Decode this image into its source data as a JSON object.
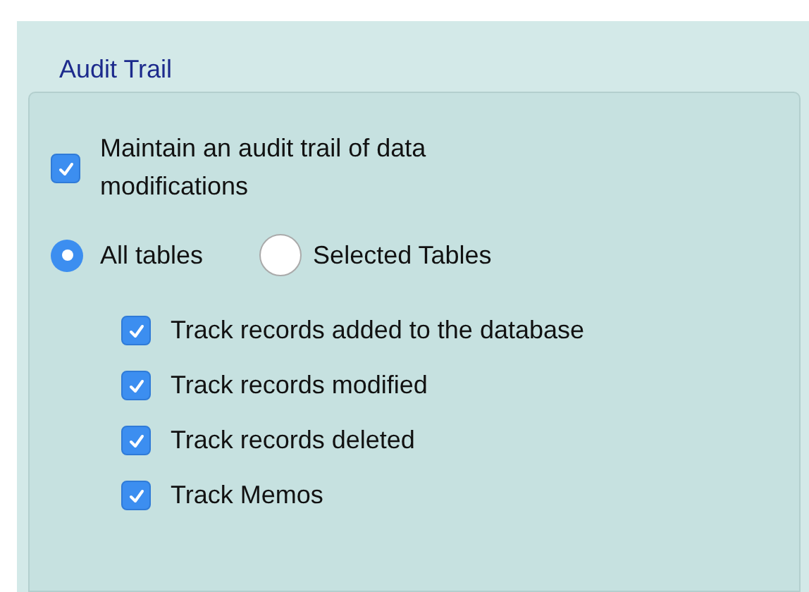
{
  "section": {
    "title": "Audit Trail"
  },
  "maintain": {
    "label": "Maintain an audit trail of data modifications",
    "checked": true
  },
  "scope": [
    {
      "label": "All tables",
      "selected": true
    },
    {
      "label": "Selected Tables",
      "selected": false
    }
  ],
  "tracks": [
    {
      "label": "Track records added to the database",
      "checked": true
    },
    {
      "label": "Track records modified",
      "checked": true
    },
    {
      "label": "Track records deleted",
      "checked": true
    },
    {
      "label": "Track Memos",
      "checked": true
    }
  ]
}
